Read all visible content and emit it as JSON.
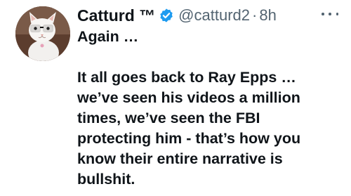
{
  "tweet": {
    "display_name": "Catturd ™",
    "handle": "@catturd2",
    "separator": "·",
    "time": "8h",
    "verified": true,
    "verified_color": "#1d9bf0",
    "more_icon": "ellipsis-icon",
    "text_line_1": "Again …",
    "text_lines": [
      "It all goes back to Ray Epps …",
      "we’ve seen his videos a million",
      "times, we’ve seen the FBI",
      "protecting him - that’s how you",
      "know their entire narrative is",
      "bullshit."
    ]
  }
}
